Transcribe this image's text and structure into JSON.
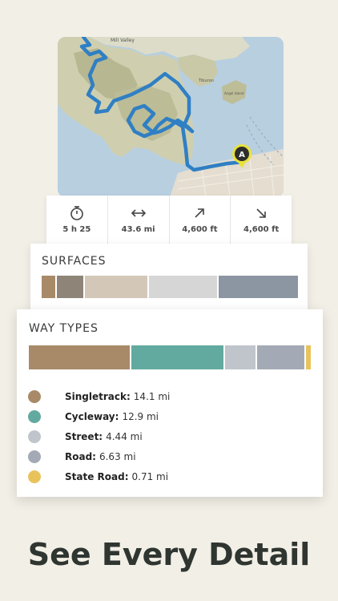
{
  "map": {
    "labels": {
      "mill_valley": "Mill Valley",
      "tiburon": "Tiburon",
      "angel_island": "Angel Island"
    },
    "marker_label": "A",
    "route_color": "#2f7fc4"
  },
  "stats": [
    {
      "icon": "stopwatch-icon",
      "value": "5 h 25"
    },
    {
      "icon": "distance-arrows-icon",
      "value": "43.6 mi"
    },
    {
      "icon": "arrow-up-right-icon",
      "value": "4,600 ft"
    },
    {
      "icon": "arrow-down-right-icon",
      "value": "4,600 ft"
    }
  ],
  "surfaces": {
    "title": "SURFACES",
    "segments": [
      {
        "color": "#a88a68",
        "fraction": 0.06
      },
      {
        "color": "#8e8478",
        "fraction": 0.11
      },
      {
        "color": "#d3c8b8",
        "fraction": 0.25
      },
      {
        "color": "#d6d6d6",
        "fraction": 0.27
      },
      {
        "color": "#8c96a2",
        "fraction": 0.31
      }
    ]
  },
  "way_types": {
    "title": "WAY TYPES",
    "items": [
      {
        "name": "Singletrack:",
        "value": "14.1 mi",
        "color": "#a88a68",
        "miles": 14.1
      },
      {
        "name": "Cycleway:",
        "value": "12.9 mi",
        "color": "#62aa9f",
        "miles": 12.9
      },
      {
        "name": "Street:",
        "value": "4.44 mi",
        "color": "#bfc5cb",
        "miles": 4.44
      },
      {
        "name": "Road:",
        "value": "6.63 mi",
        "color": "#a3aab5",
        "miles": 6.63
      },
      {
        "name": "State Road:",
        "value": "0.71 mi",
        "color": "#e8c35c",
        "miles": 0.71
      }
    ]
  },
  "headline": "See Every Detail"
}
